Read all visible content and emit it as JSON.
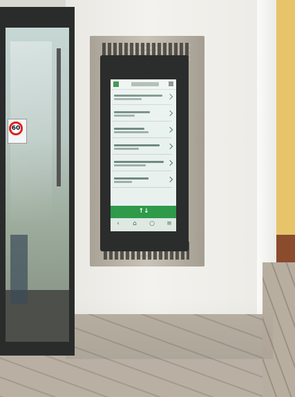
{
  "photo": {
    "subject": "wall-mounted-information-kiosk",
    "door_sign": {
      "text": "60",
      "color": "#d22222"
    },
    "kiosk_screen": {
      "accent_color": "#2e9a4a",
      "list_rows": 6,
      "bottom_nav_icons": [
        "back-icon",
        "home-icon",
        "search-icon",
        "menu-icon"
      ]
    }
  }
}
